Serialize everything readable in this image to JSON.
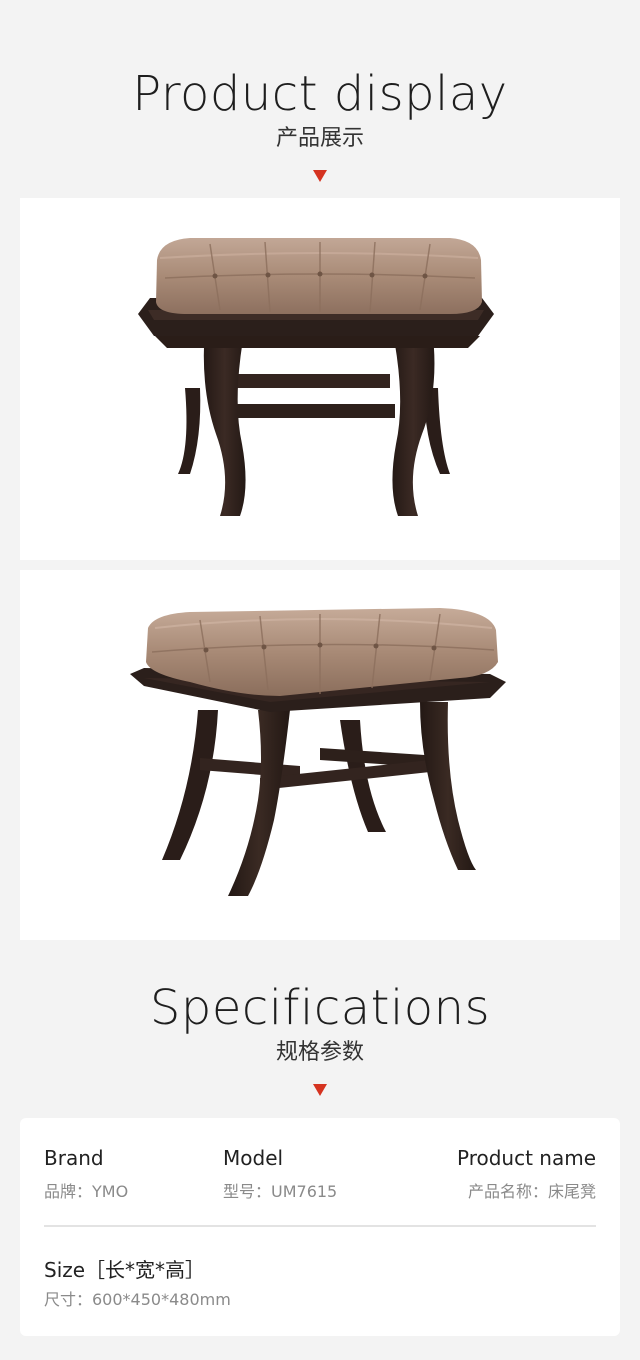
{
  "product_display": {
    "title_en": "Product display",
    "title_cn": "产品展示"
  },
  "specifications": {
    "title_en": "Specifications",
    "title_cn": "规格参数",
    "brand": {
      "label": "Brand",
      "value": "品牌：YMO"
    },
    "model": {
      "label": "Model",
      "value": "型号：UM7615"
    },
    "product_name": {
      "label": "Product name",
      "value": "产品名称：床尾凳"
    },
    "size": {
      "label": "Size［长*宽*高］",
      "value": "尺寸：600*450*480mm"
    }
  },
  "colors": {
    "accent": "#d53320",
    "leather": "#a88a76",
    "wood": "#2c1f1b",
    "background": "#f3f3f3"
  }
}
